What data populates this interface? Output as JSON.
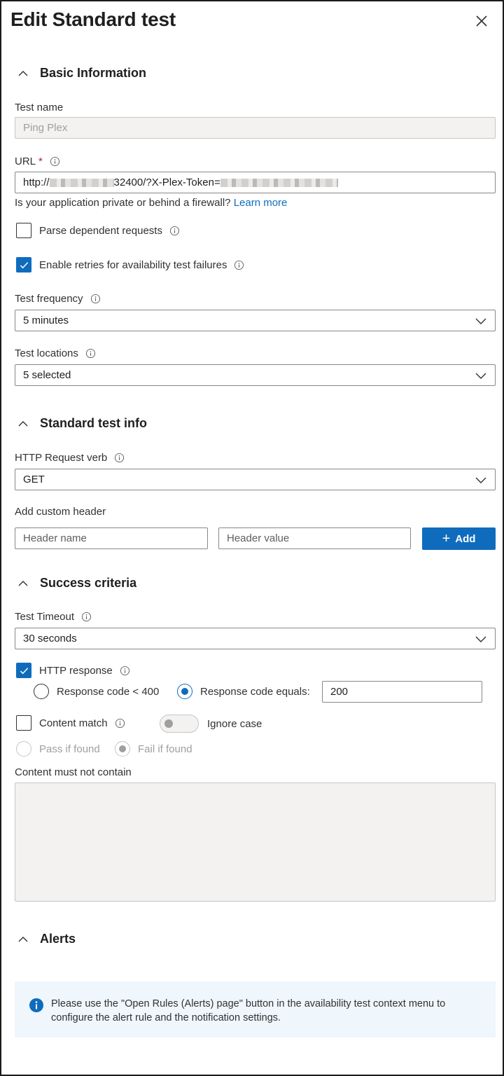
{
  "panel": {
    "title": "Edit Standard test",
    "close_icon": "close-icon"
  },
  "basic": {
    "heading": "Basic Information",
    "test_name_label": "Test name",
    "test_name_value": "Ping Plex",
    "url_label": "URL",
    "url_required": "*",
    "url_prefix": "http://",
    "url_mid": "32400/?X-Plex-Token=",
    "firewall_text": "Is your application private or behind a firewall?",
    "learn_more": "Learn more",
    "parse_label": "Parse dependent requests",
    "parse_checked": false,
    "retries_label": "Enable retries for availability test failures",
    "retries_checked": true,
    "frequency_label": "Test frequency",
    "frequency_value": "5 minutes",
    "locations_label": "Test locations",
    "locations_value": "5 selected"
  },
  "standard": {
    "heading": "Standard test info",
    "verb_label": "HTTP Request verb",
    "verb_value": "GET",
    "custom_header_label": "Add custom header",
    "header_name_placeholder": "Header name",
    "header_value_placeholder": "Header value",
    "add_button": "Add"
  },
  "success": {
    "heading": "Success criteria",
    "timeout_label": "Test Timeout",
    "timeout_value": "30 seconds",
    "http_response_label": "HTTP response",
    "http_response_checked": true,
    "radio_lt400": "Response code < 400",
    "radio_equals": "Response code equals:",
    "response_code_value": "200",
    "content_match_label": "Content match",
    "content_match_checked": false,
    "ignore_case_label": "Ignore case",
    "pass_if_found": "Pass if found",
    "fail_if_found": "Fail if found",
    "must_not_contain_label": "Content must not contain"
  },
  "alerts": {
    "heading": "Alerts",
    "notice_line1": "Please use the \"Open Rules (Alerts) page\" button in the availability test context menu to",
    "notice_line2": "configure the alert rule and the notification settings."
  },
  "colors": {
    "accent": "#0f6cbd",
    "required": "#a4262c",
    "notice_bg": "#eff6fc"
  }
}
